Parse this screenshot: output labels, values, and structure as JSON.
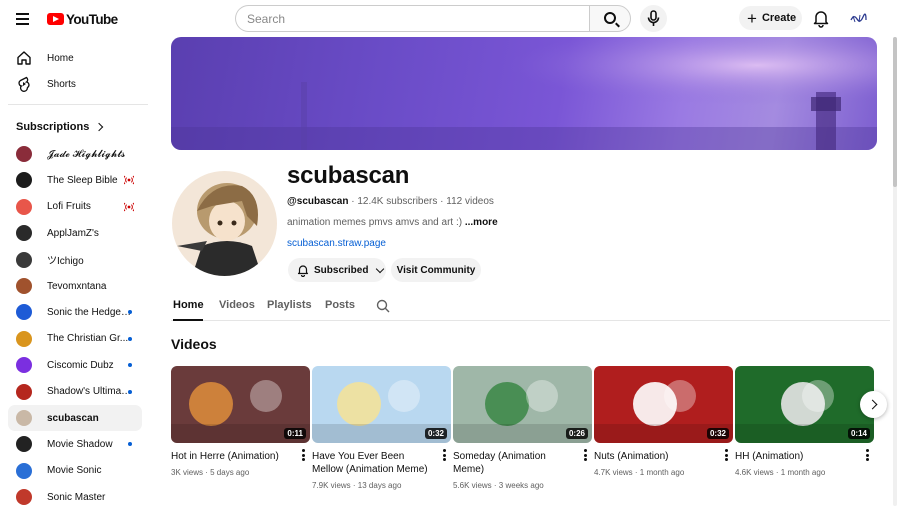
{
  "topbar": {
    "logo_text": "YouTube",
    "search_placeholder": "Search",
    "create_label": "Create"
  },
  "sidebar": {
    "nav": [
      {
        "label": "Home",
        "icon": "home-icon"
      },
      {
        "label": "Shorts",
        "icon": "shorts-icon"
      }
    ],
    "subscriptions_title": "Subscriptions",
    "subscriptions": [
      {
        "label": "𝓙𝓪𝓭𝓮 𝓗𝓲𝓰𝓱𝓵𝓲𝓰𝓱𝓽𝓼",
        "color": "#8a2c3a",
        "indicator": "none"
      },
      {
        "label": "The Sleep Bible",
        "color": "#1c1c1c",
        "indicator": "live"
      },
      {
        "label": "Lofi Fruits",
        "color": "#e8564a",
        "indicator": "live"
      },
      {
        "label": "ApplJamZ's",
        "color": "#2a2a2a",
        "indicator": "none"
      },
      {
        "label": "ツIchigo",
        "color": "#3a3a3a",
        "indicator": "none"
      },
      {
        "label": "Tevomxntana",
        "color": "#a0522d",
        "indicator": "none"
      },
      {
        "label": "Sonic the Hedgehog",
        "color": "#1e5bd6",
        "indicator": "dot"
      },
      {
        "label": "The Christian Gr...",
        "color": "#d9951e",
        "indicator": "dot"
      },
      {
        "label": "Ciscomic Dubz",
        "color": "#7b2fe0",
        "indicator": "dot"
      },
      {
        "label": "Shadow's Ultimate ...",
        "color": "#b5271e",
        "indicator": "dot"
      },
      {
        "label": "scubascan",
        "color": "#c9b8a6",
        "indicator": "none"
      },
      {
        "label": "Movie Shadow",
        "color": "#222222",
        "indicator": "dot"
      },
      {
        "label": "Movie Sonic",
        "color": "#2a6fd6",
        "indicator": "none"
      },
      {
        "label": "Sonic Master",
        "color": "#c0392b",
        "indicator": "none"
      }
    ]
  },
  "channel": {
    "name": "scubascan",
    "handle": "@scubascan",
    "subscribers": "12.4K subscribers",
    "videos_count": "112 videos",
    "description": "animation memes pmvs amvs and art :)",
    "more": "...more",
    "link": "scubascan.straw.page",
    "subscribed_label": "Subscribed",
    "community_label": "Visit Community"
  },
  "tabs": [
    "Home",
    "Videos",
    "Playlists",
    "Posts"
  ],
  "section_title": "Videos",
  "videos": [
    {
      "title": "Hot in Herre (Animation)",
      "views": "3K views",
      "age": "5 days ago",
      "duration": "0:11",
      "thumb_bg": "#6a3b3b",
      "thumb_fg": "#d88a3c"
    },
    {
      "title": "Have You Ever Been Mellow (Animation Meme)",
      "views": "7.9K views",
      "age": "13 days ago",
      "duration": "0:32",
      "thumb_bg": "#b9d8f0",
      "thumb_fg": "#f3e29a"
    },
    {
      "title": "Someday (Animation Meme)",
      "views": "5.6K views",
      "age": "3 weeks ago",
      "duration": "0:26",
      "thumb_bg": "#9fb7a8",
      "thumb_fg": "#3f8a4a"
    },
    {
      "title": "Nuts (Animation)",
      "views": "4.7K views",
      "age": "1 month ago",
      "duration": "0:32",
      "thumb_bg": "#b01e1e",
      "thumb_fg": "#ffffff"
    },
    {
      "title": "HH (Animation)",
      "views": "4.6K views",
      "age": "1 month ago",
      "duration": "0:14",
      "thumb_bg": "#1f6b2a",
      "thumb_fg": "#e6e6e6"
    }
  ]
}
